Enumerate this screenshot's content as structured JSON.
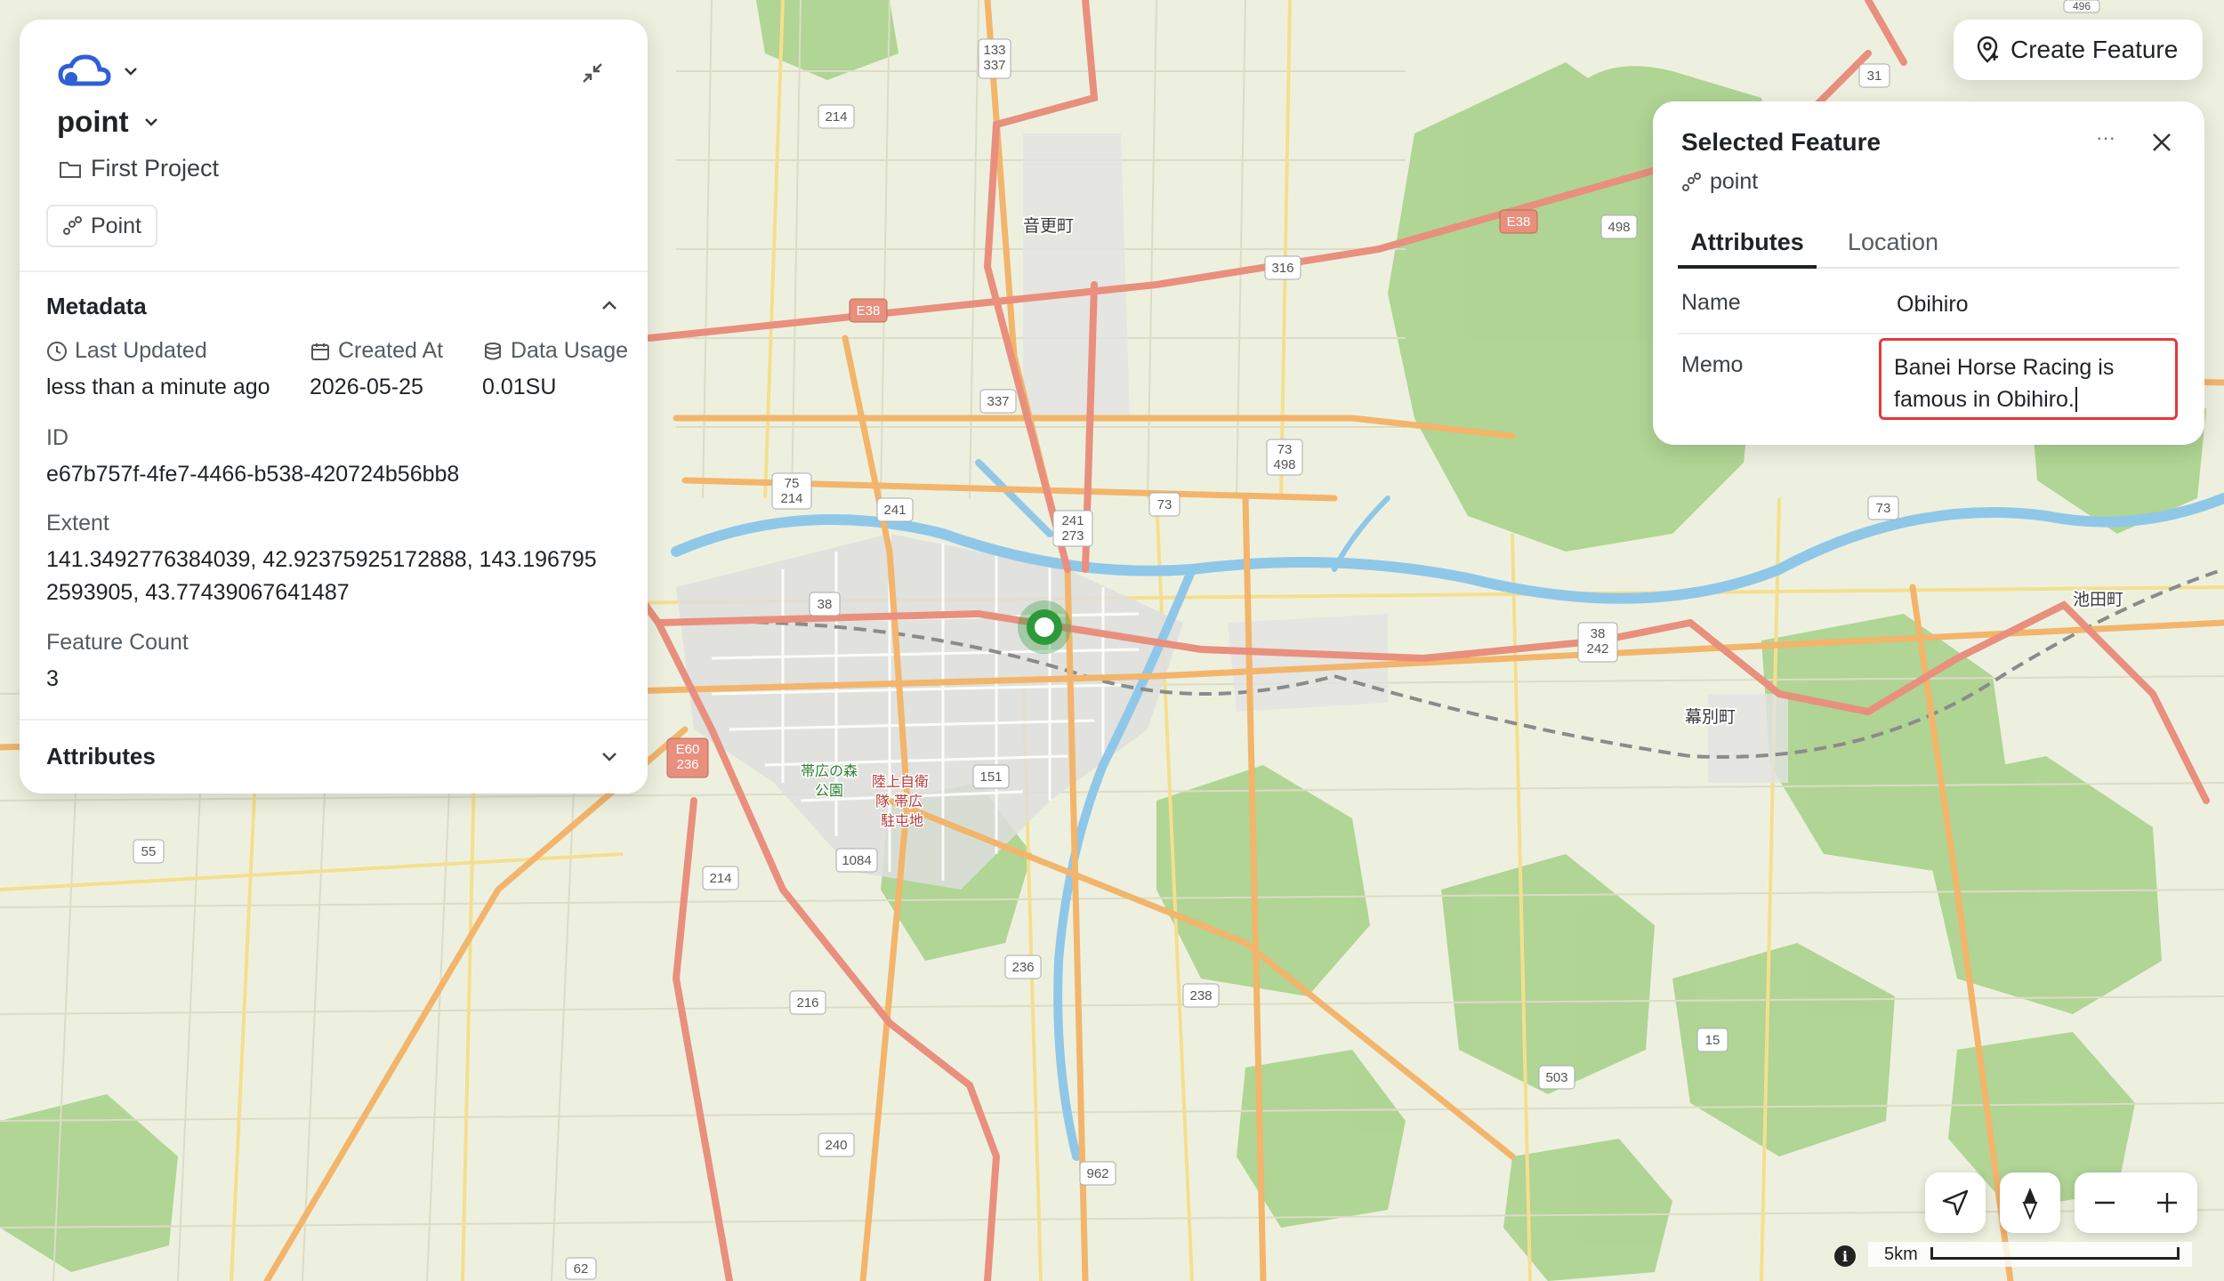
{
  "app": {
    "layer_name": "point",
    "project_name": "First Project",
    "geometry_type": "Point"
  },
  "metadata": {
    "title": "Metadata",
    "last_updated_label": "Last Updated",
    "last_updated_value": "less than a minute ago",
    "created_at_label": "Created At",
    "created_at_value": "2026-05-25",
    "data_usage_label": "Data Usage",
    "data_usage_value": "0.01SU",
    "id_label": "ID",
    "id_value": "e67b757f-4fe7-4466-b538-420724b56bb8",
    "extent_label": "Extent",
    "extent_line1": "141.3492776384039, 42.92375925172888, 143.196795",
    "extent_line2": "2593905, 43.77439067641487",
    "feature_count_label": "Feature Count",
    "feature_count_value": "3"
  },
  "attributes_section": {
    "title": "Attributes"
  },
  "toolbar": {
    "create_feature_label": "Create Feature"
  },
  "selected_feature": {
    "title": "Selected Feature",
    "layer": "point",
    "more_label": "···",
    "tabs": [
      {
        "label": "Attributes",
        "active": true
      },
      {
        "label": "Location",
        "active": false
      }
    ],
    "fields": {
      "name_label": "Name",
      "name_value": "Obihiro",
      "memo_label": "Memo",
      "memo_value": "Banei Horse Racing is famous in Obihiro."
    }
  },
  "map": {
    "scale_label": "5km",
    "place_labels": {
      "otofuke": "音更町",
      "makubetsu": "幕別町",
      "ikeda": "池田町",
      "forest_park_1": "帯広の森",
      "forest_park_2": "公園",
      "garrison_1": "陸上自衛",
      "garrison_2": "隊 帯広",
      "garrison_3": "駐屯地"
    },
    "road_shields": {
      "r133_337": "133 337",
      "r214a": "214",
      "r337": "337",
      "e38a": "E38",
      "r316": "316",
      "e38b": "E38",
      "r498": "498",
      "r31": "31",
      "r75_214": "75 214",
      "r241": "241",
      "r241_273": "241 273",
      "r73a": "73",
      "r73_498": "73 498",
      "r73b": "73",
      "r38a": "38",
      "r38_242": "38 242",
      "e60_236": "E60 236",
      "r151": "151",
      "r1084": "1084",
      "r214b": "214",
      "r55": "55",
      "r236": "236",
      "r238": "238",
      "r216": "216",
      "r15": "15",
      "r503": "503",
      "r240": "240",
      "r962": "962",
      "r62": "62",
      "r496": "496"
    },
    "colors": {
      "land": "#eef0df",
      "forest": "#a8d18b",
      "river": "#8fc7e8",
      "motorway": "#e98f7e",
      "primary": "#f2b56b",
      "selected_marker": "#2d9a3a"
    }
  }
}
